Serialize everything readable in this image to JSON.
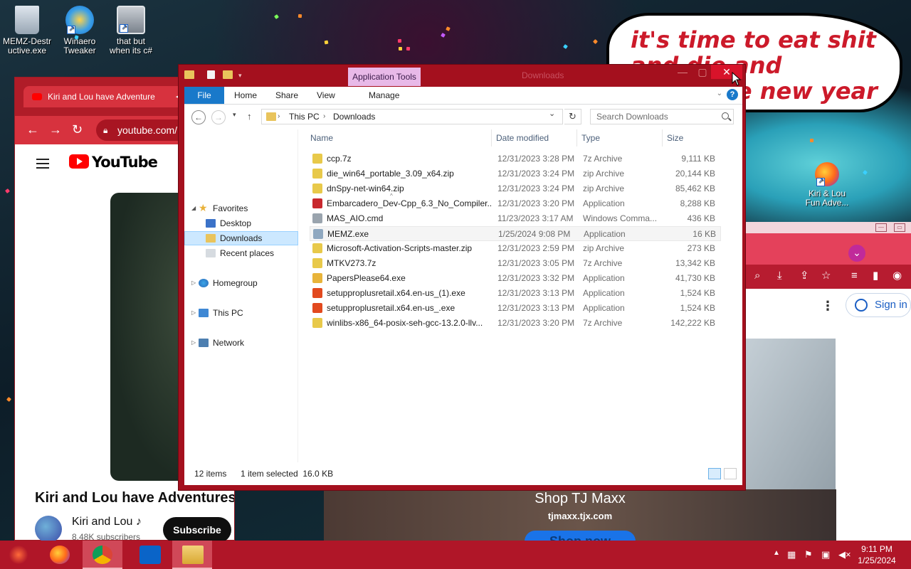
{
  "desktop": {
    "icons": [
      {
        "label_line1": "MEMZ-Destr",
        "label_line2": "uctive.exe",
        "icon": "recycle-bin-icon"
      },
      {
        "label_line1": "Winaero",
        "label_line2": "Tweaker",
        "icon": "winaero-icon"
      },
      {
        "label_line1": "that but",
        "label_line2": "when its c#",
        "icon": "window-stack-icon"
      },
      {
        "label_line1": "Kiri & Lou",
        "label_line2": "Fun Adve...",
        "icon": "firefox-icon"
      }
    ],
    "bubble_text": "it's time to eat shit and die and celebrate new year"
  },
  "youtube_window": {
    "tab_title": "Kiri and Lou have Adventure",
    "url": "youtube.com/",
    "logo_text": "YouTube",
    "video_title": "Kiri and Lou have Adventures i",
    "channel_name": "Kiri and Lou ♪",
    "subscribers": "8.48K subscribers",
    "subscribe_label": "Subscribe"
  },
  "right_browser": {
    "signin_label": "Sign in",
    "more_glyph": "⋮"
  },
  "ad": {
    "title": "Shop TJ Maxx",
    "url": "tjmaxx.tjx.com",
    "button": "Shop now"
  },
  "explorer": {
    "title": "Downloads",
    "context_tab": "Application Tools",
    "ribbon_tabs": {
      "file": "File",
      "home": "Home",
      "share": "Share",
      "view": "View",
      "manage": "Manage"
    },
    "breadcrumb": [
      "This PC",
      "Downloads"
    ],
    "search_placeholder": "Search Downloads",
    "nav_pane": {
      "favorites": "Favorites",
      "desktop": "Desktop",
      "downloads": "Downloads",
      "recent": "Recent places",
      "homegroup": "Homegroup",
      "thispc": "This PC",
      "network": "Network"
    },
    "columns": {
      "name": "Name",
      "date": "Date modified",
      "type": "Type",
      "size": "Size"
    },
    "files": [
      {
        "name": "ccp.7z",
        "date": "12/31/2023 3:28 PM",
        "type": "7z Archive",
        "size": "9,111 KB",
        "icon": "archive-icon",
        "color": "#e8c94a"
      },
      {
        "name": "die_win64_portable_3.09_x64.zip",
        "date": "12/31/2023 3:24 PM",
        "type": "zip Archive",
        "size": "20,144 KB",
        "icon": "archive-icon",
        "color": "#e8c94a"
      },
      {
        "name": "dnSpy-net-win64.zip",
        "date": "12/31/2023 3:24 PM",
        "type": "zip Archive",
        "size": "85,462 KB",
        "icon": "archive-icon",
        "color": "#e8c94a"
      },
      {
        "name": "Embarcadero_Dev-Cpp_6.3_No_Compiler...",
        "date": "12/31/2023 3:20 PM",
        "type": "Application",
        "size": "8,288 KB",
        "icon": "embarcadero-icon",
        "color": "#c8282e"
      },
      {
        "name": "MAS_AIO.cmd",
        "date": "11/23/2023 3:17 AM",
        "type": "Windows Comma...",
        "size": "436 KB",
        "icon": "cmd-file-icon",
        "color": "#9aa4ae"
      },
      {
        "name": "MEMZ.exe",
        "date": "1/25/2024 9:08 PM",
        "type": "Application",
        "size": "16 KB",
        "icon": "exe-icon",
        "color": "#8fa8c0"
      },
      {
        "name": "Microsoft-Activation-Scripts-master.zip",
        "date": "12/31/2023 2:59 PM",
        "type": "zip Archive",
        "size": "273 KB",
        "icon": "archive-icon",
        "color": "#e8c94a"
      },
      {
        "name": "MTKV273.7z",
        "date": "12/31/2023 3:05 PM",
        "type": "7z Archive",
        "size": "13,342 KB",
        "icon": "archive-icon",
        "color": "#e8c94a"
      },
      {
        "name": "PapersPlease64.exe",
        "date": "12/31/2023 3:32 PM",
        "type": "Application",
        "size": "41,730 KB",
        "icon": "papers-please-icon",
        "color": "#e8b43a"
      },
      {
        "name": "setupproplusretail.x64.en-us_(1).exe",
        "date": "12/31/2023 3:13 PM",
        "type": "Application",
        "size": "1,524 KB",
        "icon": "office-icon",
        "color": "#e2491e"
      },
      {
        "name": "setupproplusretail.x64.en-us_.exe",
        "date": "12/31/2023 3:13 PM",
        "type": "Application",
        "size": "1,524 KB",
        "icon": "office-icon",
        "color": "#e2491e"
      },
      {
        "name": "winlibs-x86_64-posix-seh-gcc-13.2.0-llv...",
        "date": "12/31/2023 3:20 PM",
        "type": "7z Archive",
        "size": "142,222 KB",
        "icon": "archive-icon",
        "color": "#e8c94a"
      }
    ],
    "selected_index": 5,
    "status_items": "12 items",
    "status_selected": "1 item selected  16.0 KB"
  },
  "taskbar": {
    "time": "9:11 PM",
    "date": "1/25/2024"
  },
  "colors": {
    "accent": "#a4101e",
    "ribbon_file": "#1979ca",
    "taskbar": "#b01628",
    "selection": "#cce8ff"
  }
}
